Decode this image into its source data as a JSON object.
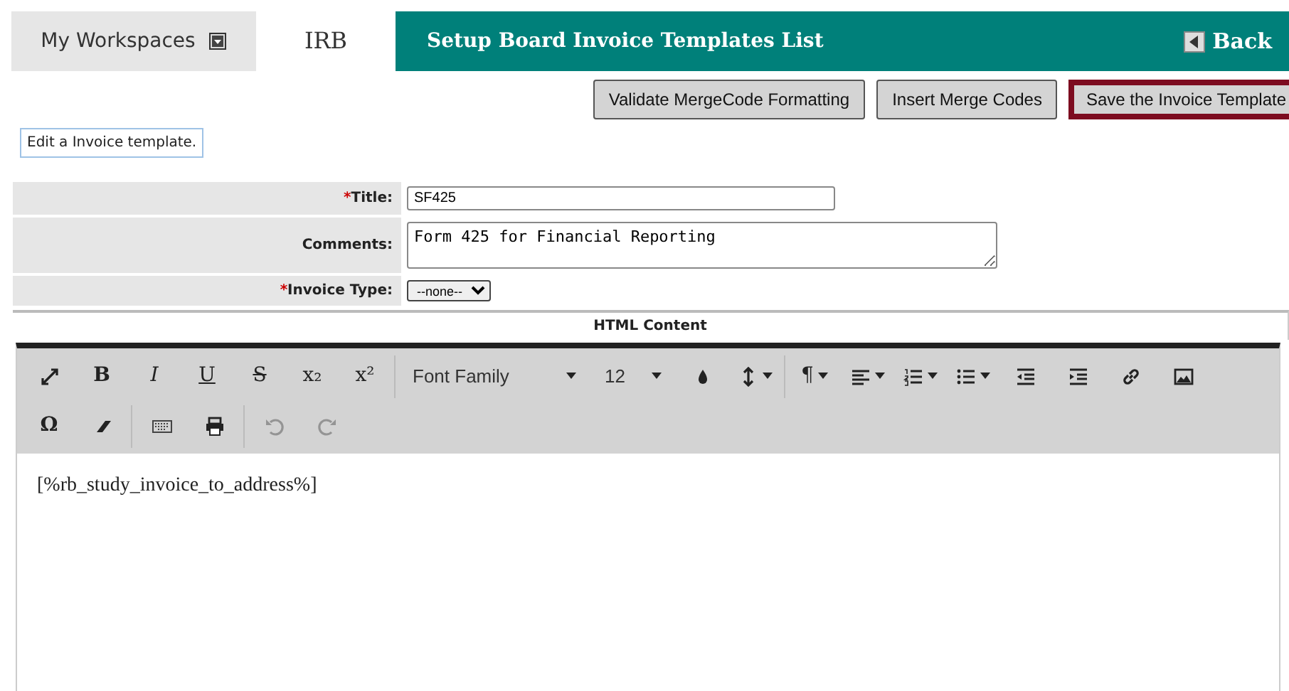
{
  "top_tabs": [
    {
      "label": "My Workspaces",
      "dropdown": true,
      "selected": false
    },
    {
      "label": "IRB",
      "dropdown": false,
      "selected": true
    }
  ],
  "header": {
    "title": "Setup Board Invoice Templates List",
    "back": "Back"
  },
  "actions": [
    {
      "label": "Validate MergeCode Formatting",
      "primary": false
    },
    {
      "label": "Insert Merge Codes",
      "primary": false
    },
    {
      "label": "Save the Invoice Template",
      "primary": true
    }
  ],
  "hint": "Edit a Invoice template.",
  "form": [
    {
      "kind": "text",
      "marker": "*",
      "label": "Title:",
      "value": "SF425"
    },
    {
      "kind": "textarea",
      "label": "Comments:",
      "value": "Form 425 for Financial Reporting"
    },
    {
      "kind": "select",
      "marker": "*",
      "label": "Invoice Type:",
      "value": "--none--"
    }
  ],
  "section_title": "HTML Content",
  "toolbar": [
    [
      {
        "kind": "icon",
        "caret": false,
        "disabled": false
      },
      {
        "kind": "glyph",
        "text": "B",
        "caret": false
      },
      {
        "kind": "glyph",
        "text": "I",
        "caret": false
      },
      {
        "kind": "glyph",
        "text": "U",
        "caret": false
      },
      {
        "kind": "glyph",
        "text": "S",
        "caret": false
      },
      {
        "kind": "glyph",
        "text": "x₂",
        "caret": false
      },
      {
        "kind": "glyph",
        "text": "x²",
        "caret": false
      },
      {
        "kind": "sep"
      },
      {
        "kind": "select",
        "text": "Font Family",
        "wide": true
      },
      {
        "kind": "select",
        "text": "12",
        "wide": false
      },
      {
        "kind": "icon",
        "caret": false,
        "disabled": false
      },
      {
        "kind": "icon",
        "caret": true,
        "disabled": false
      },
      {
        "kind": "sep"
      },
      {
        "kind": "glyph",
        "text": "¶",
        "caret": true
      },
      {
        "kind": "icon",
        "caret": true,
        "disabled": false
      },
      {
        "kind": "icon",
        "caret": true,
        "disabled": false
      },
      {
        "kind": "icon",
        "caret": true,
        "disabled": false
      },
      {
        "kind": "icon",
        "caret": false,
        "disabled": false
      },
      {
        "kind": "icon",
        "caret": false,
        "disabled": false
      },
      {
        "kind": "icon",
        "caret": false,
        "disabled": false
      },
      {
        "kind": "icon",
        "caret": false,
        "disabled": false
      }
    ],
    [
      {
        "kind": "glyph",
        "text": "Ω",
        "caret": false
      },
      {
        "kind": "icon",
        "caret": false,
        "disabled": false
      },
      {
        "kind": "sep"
      },
      {
        "kind": "icon",
        "caret": false,
        "disabled": false
      },
      {
        "kind": "icon",
        "caret": false,
        "disabled": false
      },
      {
        "kind": "sep"
      },
      {
        "kind": "icon",
        "caret": false,
        "disabled": true
      },
      {
        "kind": "icon",
        "caret": false,
        "disabled": true
      }
    ]
  ],
  "editor_content": "[%rb_study_invoice_to_address%]"
}
